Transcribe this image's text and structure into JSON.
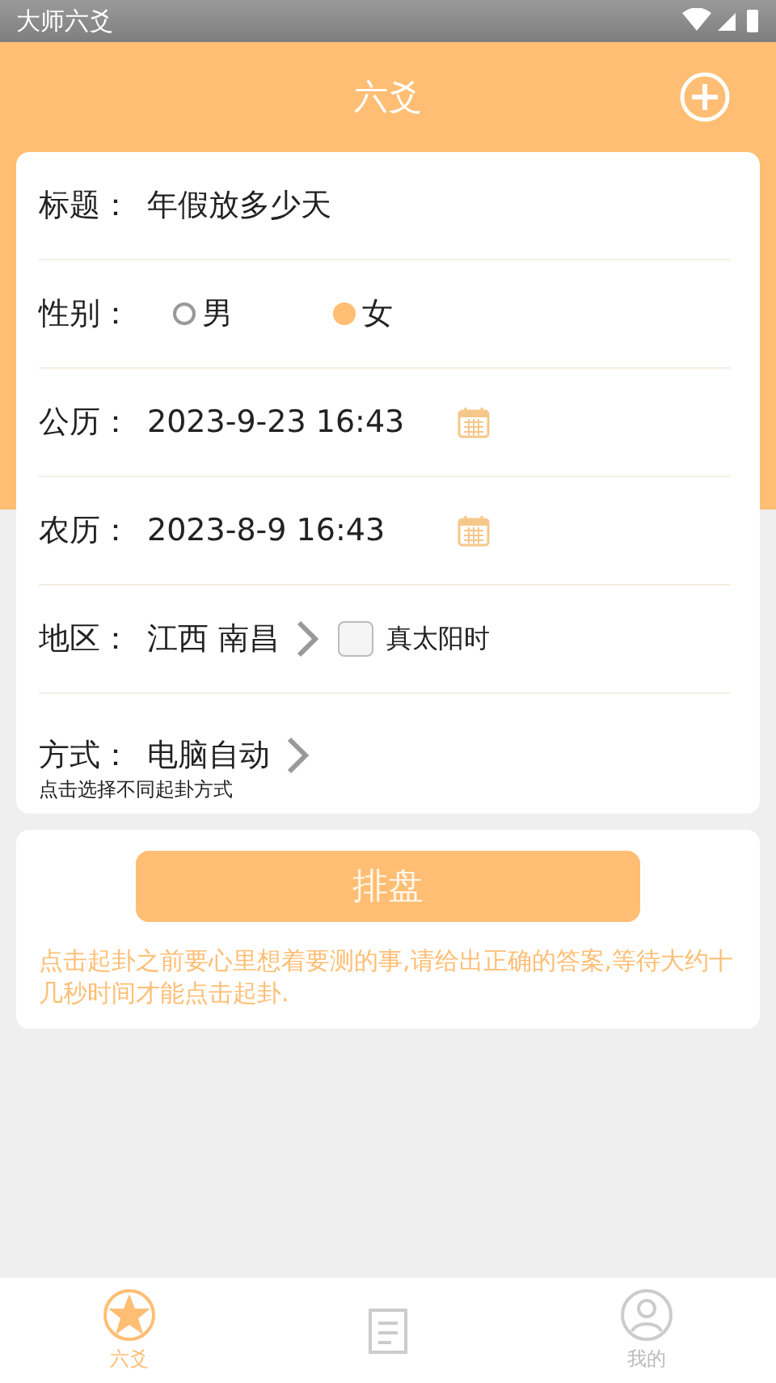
{
  "status_bar": {
    "app_name": "大师六爻"
  },
  "header": {
    "title": "六爻"
  },
  "form": {
    "rows": [
      {
        "kind": "text",
        "label": "标题：",
        "value": "年假放多少天"
      },
      {
        "kind": "gender",
        "label": "性别：",
        "options": [
          {
            "label": "男",
            "selected": false
          },
          {
            "label": "女",
            "selected": true
          }
        ]
      },
      {
        "kind": "date",
        "label": "公历：",
        "value": "2023-9-23 16:43"
      },
      {
        "kind": "date",
        "label": "农历：",
        "value": "2023-8-9 16:43"
      },
      {
        "kind": "region",
        "label": "地区：",
        "value": "江西 南昌",
        "checkbox": {
          "label": "真太阳时",
          "checked": false
        }
      },
      {
        "kind": "method",
        "label": "方式：",
        "value": "电脑自动",
        "hint": "点击选择不同起卦方式"
      }
    ]
  },
  "action": {
    "button": "排盘",
    "note": "点击起卦之前要心里想着要测的事,请给出正确的答案,等待大约十几秒时间才能点击起卦."
  },
  "bottom_nav": [
    {
      "kind": "star",
      "label": "六爻",
      "selected": true
    },
    {
      "kind": "list",
      "selected": false
    },
    {
      "kind": "person",
      "label": "我的",
      "selected": false
    }
  ]
}
